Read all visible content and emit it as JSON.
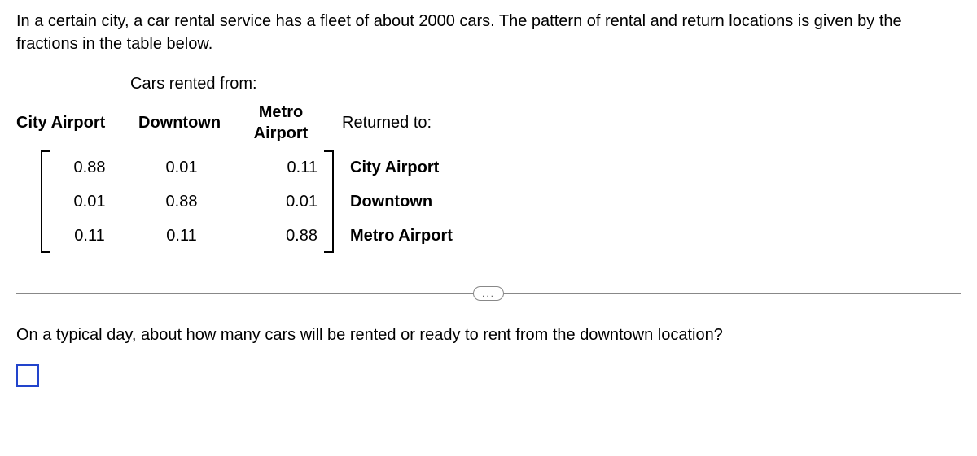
{
  "intro": "In a certain city, a car rental service has a fleet of about 2000 cars. The pattern of rental and return locations is given by the fractions in the table below.",
  "rentedFromLabel": "Cars rented from:",
  "columns": {
    "cityAirport": "City Airport",
    "downtown": "Downtown",
    "metroAirport": "Metro Airport"
  },
  "returnedToLabel": "Returned to:",
  "matrix": {
    "r0": {
      "c0": "0.88",
      "c1": "0.01",
      "c2": "0.11"
    },
    "r1": {
      "c0": "0.01",
      "c1": "0.88",
      "c2": "0.01"
    },
    "r2": {
      "c0": "0.11",
      "c1": "0.11",
      "c2": "0.88"
    }
  },
  "rowLabels": {
    "r0": "City Airport",
    "r1": "Downtown",
    "r2": "Metro Airport"
  },
  "dividerBadge": "...",
  "question": "On a typical day, about how many cars will be rented or ready to rent from the downtown location?",
  "chart_data": {
    "type": "table",
    "title": "Transition fractions: rented-from (columns) to returned-to (rows)",
    "columns": [
      "City Airport",
      "Downtown",
      "Metro Airport"
    ],
    "rows": [
      "City Airport",
      "Downtown",
      "Metro Airport"
    ],
    "values": [
      [
        0.88,
        0.01,
        0.11
      ],
      [
        0.01,
        0.88,
        0.01
      ],
      [
        0.11,
        0.11,
        0.88
      ]
    ]
  }
}
